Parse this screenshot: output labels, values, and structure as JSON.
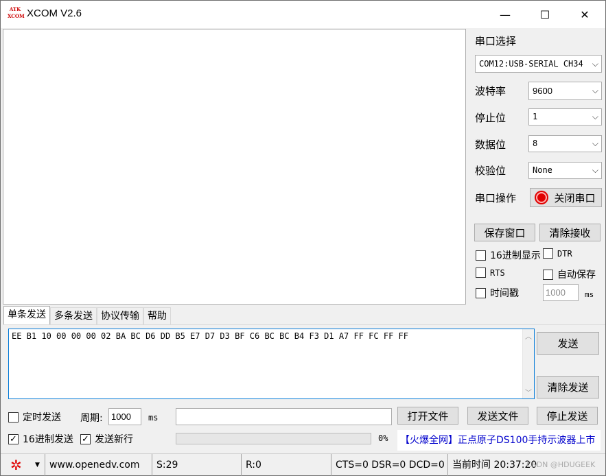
{
  "window": {
    "title": "XCOM V2.6",
    "logo_text_top": "ATK",
    "logo_text_bottom": "XCOM",
    "minimize": "—",
    "maximize": "☐",
    "close": "✕"
  },
  "serial": {
    "section_label": "串口选择",
    "port_value": "COM12:USB-SERIAL CH34",
    "baud_label": "波特率",
    "baud_value": "9600",
    "stop_label": "停止位",
    "stop_value": "1",
    "data_label": "数据位",
    "data_value": "8",
    "parity_label": "校验位",
    "parity_value": "None",
    "op_label": "串口操作",
    "op_button": "关闭串口"
  },
  "recv_buttons": {
    "save": "保存窗口",
    "clear": "清除接收"
  },
  "recv_options": {
    "hex_display": "16进制显示",
    "dtr": "DTR",
    "rts": "RTS",
    "auto_save": "自动保存",
    "timestamp": "时间戳",
    "timestamp_value": "1000",
    "timestamp_unit": "ms"
  },
  "tabs": [
    {
      "label": "单条发送"
    },
    {
      "label": "多条发送"
    },
    {
      "label": "协议传输"
    },
    {
      "label": "帮助"
    }
  ],
  "send": {
    "content": "EE B1 10 00 00 00 02 BA BC D6 DD B5 E7 D7 D3 BF C6 BC BC B4 F3 D1 A7 FF FC FF FF",
    "send_button": "发送",
    "clear_button": "清除发送"
  },
  "bottom": {
    "timed_send": "定时发送",
    "period_label": "周期:",
    "period_value": "1000",
    "period_unit": "ms",
    "open_file": "打开文件",
    "send_file": "发送文件",
    "stop_send": "停止发送",
    "hex_send": "16进制发送",
    "send_newline": "发送新行",
    "progress": "0%",
    "ad_text": "【火爆全网】正点原子DS100手持示波器上市"
  },
  "status": {
    "url": "www.openedv.com",
    "sent": "S:29",
    "received": "R:0",
    "lines": "CTS=0 DSR=0 DCD=0",
    "time": "当前时间 20:37:20",
    "watermark": "CSDN @HDUGEEK"
  },
  "colors": {
    "accent": "#0078d7",
    "ad_blue": "#0000cc",
    "status_red": "#e00000"
  }
}
